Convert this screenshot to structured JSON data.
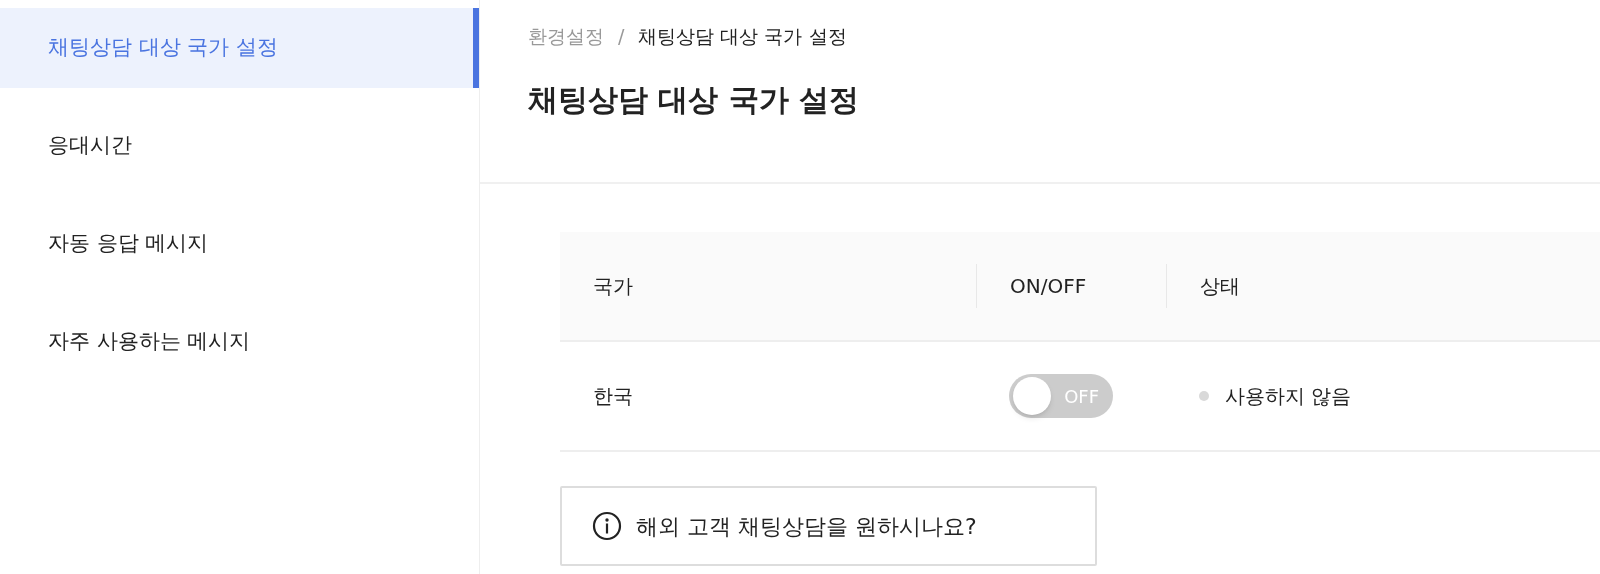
{
  "sidebar": {
    "items": [
      {
        "label": "채팅상담 대상 국가 설정",
        "selected": true
      },
      {
        "label": "응대시간",
        "selected": false
      },
      {
        "label": "자동 응답 메시지",
        "selected": false
      },
      {
        "label": "자주 사용하는 메시지",
        "selected": false
      }
    ]
  },
  "breadcrumb": [
    "환경설정",
    "/",
    "채팅상담 대상 국가 설정"
  ],
  "title": "채팅상담 대상 국가 설정",
  "table": {
    "columns": [
      "국가",
      "ON/OFF",
      "상태"
    ],
    "rows": [
      {
        "country": "한국",
        "toggle": {
          "on": false,
          "label": "OFF"
        },
        "status": {
          "color": "#d9d9d9",
          "text": "사용하지 않음"
        }
      }
    ]
  },
  "info_button": {
    "label": "해외 고객 채팅상담을 원하시나요?"
  }
}
